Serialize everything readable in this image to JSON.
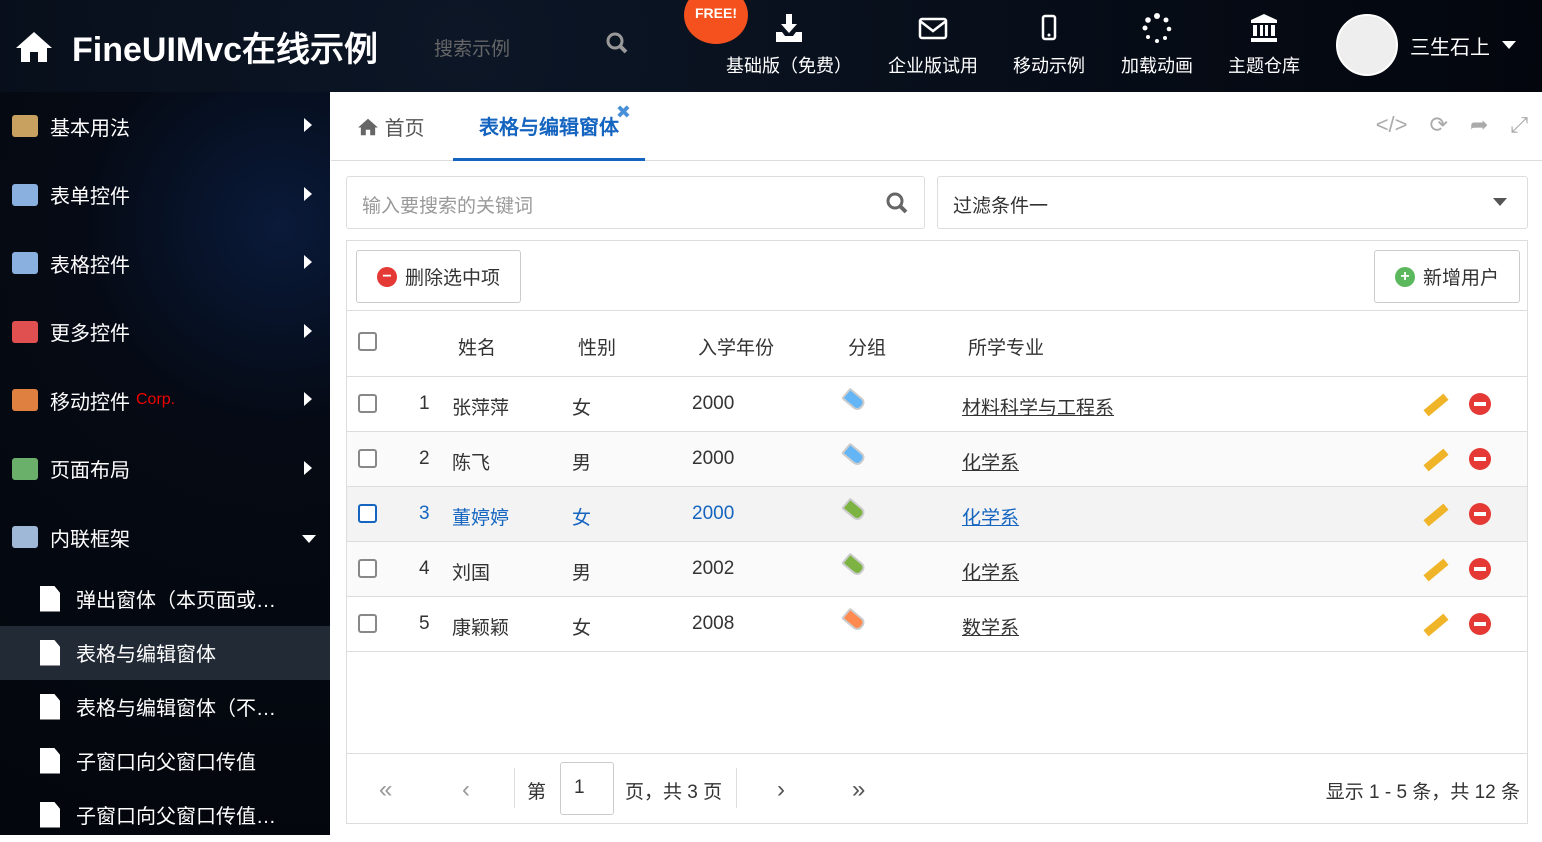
{
  "header": {
    "title": "FineUIMvc在线示例",
    "search_placeholder": "搜索示例",
    "free_badge": "FREE!",
    "nav": [
      {
        "label": "基础版（免费）",
        "icon": "download-icon"
      },
      {
        "label": "企业版试用",
        "icon": "envelope-icon"
      },
      {
        "label": "移动示例",
        "icon": "mobile-icon"
      },
      {
        "label": "加载动画",
        "icon": "spinner-icon"
      },
      {
        "label": "主题仓库",
        "icon": "bank-icon"
      }
    ],
    "user": "三生石上"
  },
  "sidebar": {
    "items": [
      {
        "label": "基本用法",
        "color": "#c8a060"
      },
      {
        "label": "表单控件",
        "color": "#8ab0e0"
      },
      {
        "label": "表格控件",
        "color": "#8ab0e0"
      },
      {
        "label": "更多控件",
        "color": "#e05050"
      },
      {
        "label": "移动控件",
        "badge": "Corp.",
        "color": "#e08040"
      },
      {
        "label": "页面布局",
        "color": "#6ab06a"
      },
      {
        "label": "内联框架",
        "color": "#a0b8d8"
      }
    ],
    "subitems": [
      "弹出窗体（本页面或…",
      "表格与编辑窗体",
      "表格与编辑窗体（不…",
      "子窗口向父窗口传值",
      "子窗口向父窗口传值…"
    ]
  },
  "tabs": {
    "home": "首页",
    "active": "表格与编辑窗体"
  },
  "search": {
    "placeholder": "输入要搜索的关键词",
    "filter": "过滤条件一"
  },
  "toolbar": {
    "delete": "删除选中项",
    "add": "新增用户"
  },
  "grid": {
    "columns": [
      "姓名",
      "性别",
      "入学年份",
      "分组",
      "所学专业"
    ],
    "rows": [
      {
        "no": "1",
        "name": "张萍萍",
        "gender": "女",
        "year": "2000",
        "tag": "#64b5f6",
        "major": "材料科学与工程系"
      },
      {
        "no": "2",
        "name": "陈飞",
        "gender": "男",
        "year": "2000",
        "tag": "#64b5f6",
        "major": "化学系"
      },
      {
        "no": "3",
        "name": "董婷婷",
        "gender": "女",
        "year": "2000",
        "tag": "#7cb342",
        "major": "化学系"
      },
      {
        "no": "4",
        "name": "刘国",
        "gender": "男",
        "year": "2002",
        "tag": "#7cb342",
        "major": "化学系"
      },
      {
        "no": "5",
        "name": "康颖颖",
        "gender": "女",
        "year": "2008",
        "tag": "#ff8a50",
        "major": "数学系"
      }
    ]
  },
  "pager": {
    "page_prefix": "第",
    "page": "1",
    "page_suffix": "页，共 3 页",
    "summary": "显示 1 - 5 条，共 12 条"
  }
}
